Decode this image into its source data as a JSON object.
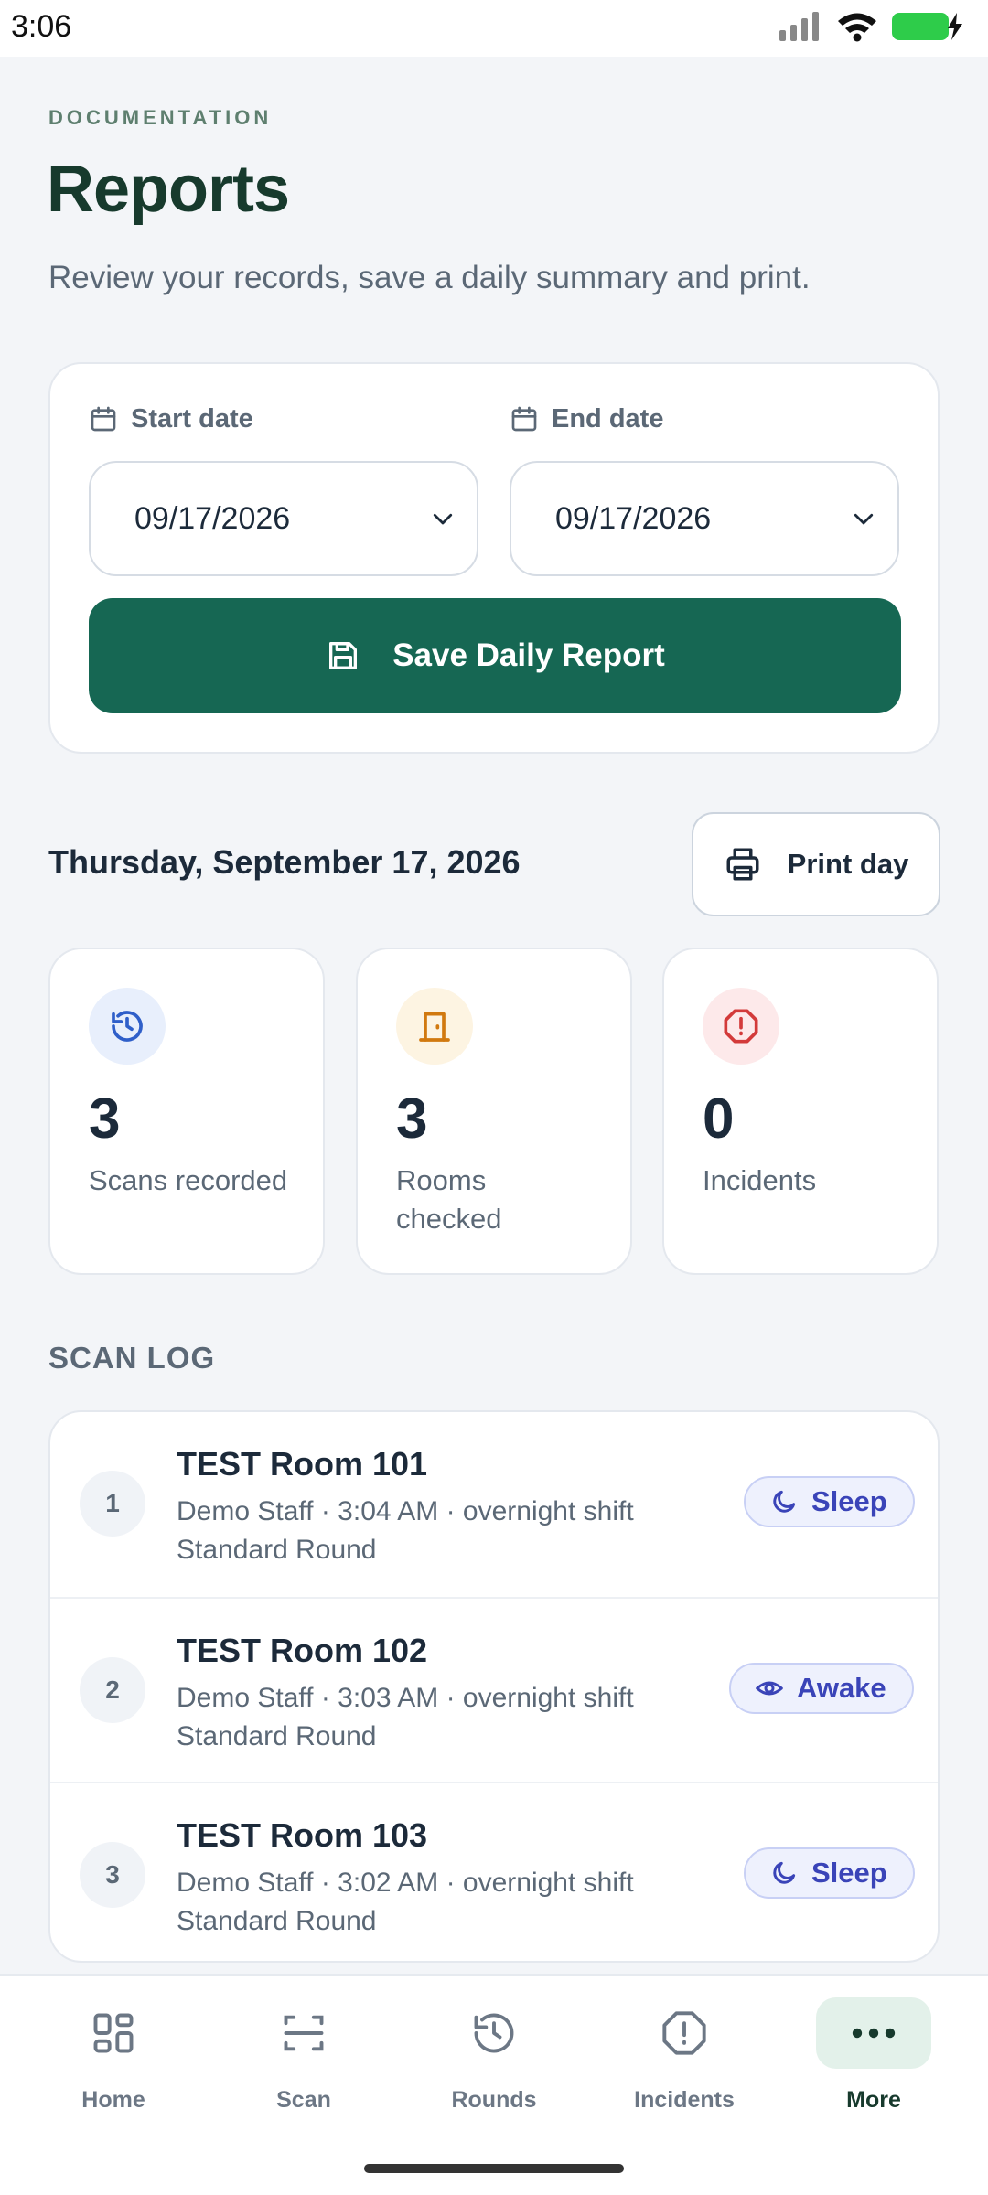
{
  "status_bar": {
    "time": "3:06"
  },
  "header": {
    "eyebrow": "DOCUMENTATION",
    "title": "Reports",
    "subtitle": "Review your records, save a daily summary and print."
  },
  "filters": {
    "start_label": "Start date",
    "start_value": "09/17/2026",
    "end_label": "End date",
    "end_value": "09/17/2026",
    "save_label": "Save Daily Report"
  },
  "day": {
    "heading": "Thursday, September 17, 2026",
    "print_label": "Print day"
  },
  "stats": [
    {
      "value": "3",
      "label": "Scans recorded",
      "icon": "history-icon",
      "color": "#2f5fc9",
      "bg": "#e8effc"
    },
    {
      "value": "3",
      "label": "Rooms checked",
      "icon": "door-icon",
      "color": "#d1790f",
      "bg": "#fdf4e2"
    },
    {
      "value": "0",
      "label": "Incidents",
      "icon": "alert-octagon-icon",
      "color": "#d33a3a",
      "bg": "#fde9ea"
    }
  ],
  "scan_log": {
    "title": "SCAN LOG",
    "rows": [
      {
        "index": "1",
        "room": "TEST Room 101",
        "meta": "Demo Staff · 3:04 AM · overnight shift",
        "round": "Standard Round",
        "status": "Sleep",
        "status_icon": "moon-icon"
      },
      {
        "index": "2",
        "room": "TEST Room 102",
        "meta": "Demo Staff · 3:03 AM · overnight shift",
        "round": "Standard Round",
        "status": "Awake",
        "status_icon": "eye-icon"
      },
      {
        "index": "3",
        "room": "TEST Room 103",
        "meta": "Demo Staff · 3:02 AM · overnight shift",
        "round": "Standard Round",
        "status": "Sleep",
        "status_icon": "moon-icon"
      }
    ]
  },
  "nav": {
    "items": [
      {
        "label": "Home",
        "icon": "grid-icon"
      },
      {
        "label": "Scan",
        "icon": "scan-icon"
      },
      {
        "label": "Rounds",
        "icon": "history-icon"
      },
      {
        "label": "Incidents",
        "icon": "alert-octagon-icon"
      },
      {
        "label": "More",
        "icon": "more-icon",
        "active": true
      }
    ]
  },
  "colors": {
    "primary": "#166753",
    "title": "#173a2d",
    "badge_text": "#3a44b8"
  }
}
